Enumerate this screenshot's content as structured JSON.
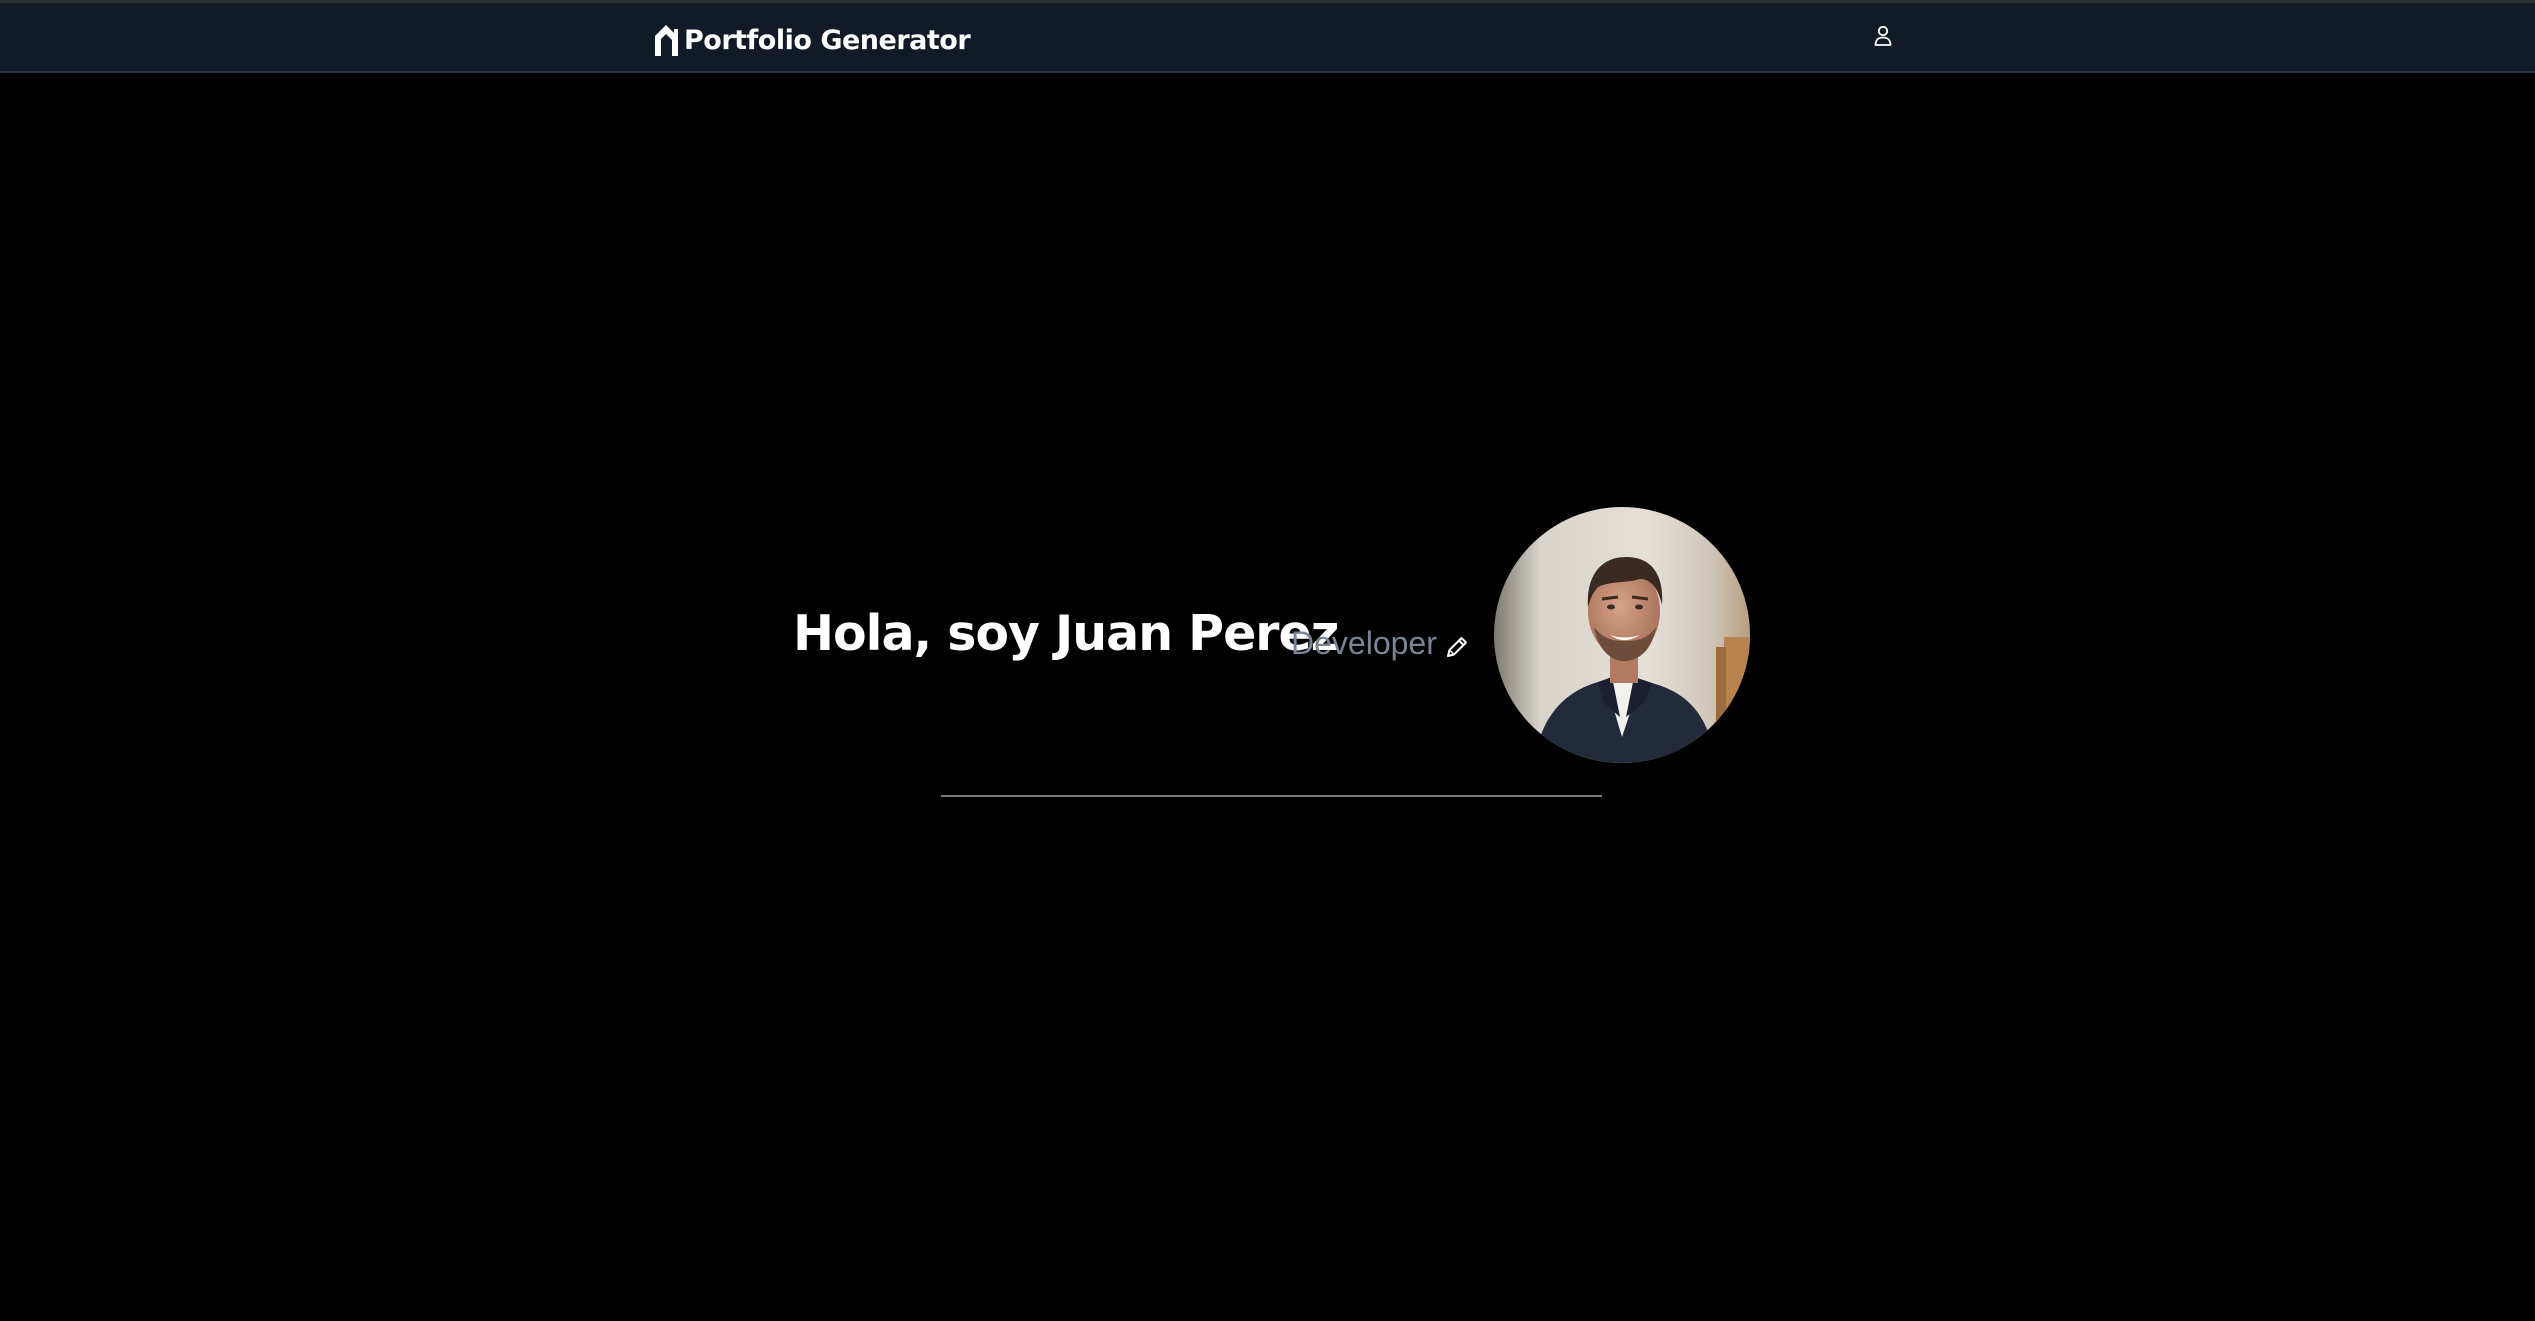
{
  "navbar": {
    "brand_label": "Portfolio Generator",
    "brand_icon": "house-outline-icon",
    "user_icon": "user-icon"
  },
  "hero": {
    "greeting": "Hola, soy Juan Perez",
    "role": "Developer",
    "edit_icon": "pencil-icon",
    "avatar_alt": "Juan Perez"
  },
  "colors": {
    "navbar_bg": "#121a28",
    "page_bg": "#000000",
    "role_text": "#7b8494",
    "divider": "#7a7a7a"
  }
}
